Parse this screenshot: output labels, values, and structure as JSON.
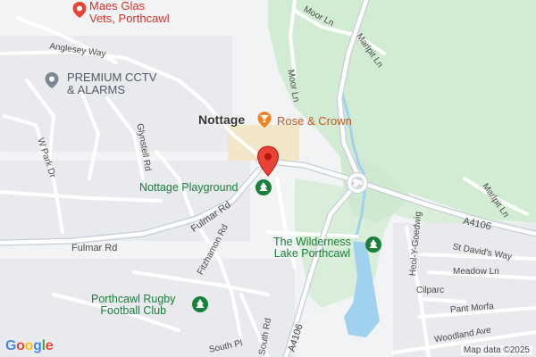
{
  "map": {
    "places": {
      "nottage": "Nottage"
    },
    "pois": {
      "maes_glas": {
        "line1": "Maes Glas",
        "line2": "Vets, Porthcawl"
      },
      "premium_cctv": {
        "line1": "PREMIUM CCTV",
        "line2": "& ALARMS"
      },
      "rose_crown": "Rose & Crown",
      "nottage_playground": "Nottage Playground",
      "wilderness_lake": {
        "line1": "The Wilderness",
        "line2": "Lake Porthcawl"
      },
      "porthcawl_rugby": {
        "line1": "Porthcawl Rugby",
        "line2": "Football Club"
      }
    },
    "roads": {
      "anglesey_way": "Anglesey Way",
      "moor_ln_top": "Moor Ln",
      "moor_ln_side": "Moor Ln",
      "marlpit_ln_top": "Marlpit Ln",
      "marlpit_ln_right": "Marlpit Ln",
      "w_park_dr": "W Park Dr",
      "glynstell_rd": "Glynstell Rd",
      "fulmar_rd_main": "Fulmar Rd",
      "fulmar_rd_diag": "Fulmar Rd",
      "fitzhamon_rd": "Fitzhamon Rd",
      "a4106_east": "A4106",
      "a4106_south": "A4106",
      "heol_y_goedwig": "Heol-Y-Goedwig",
      "st_davids_way": "St David's Way",
      "meadow_ln": "Meadow Ln",
      "cilparc": "Cilparc",
      "pant_morfa": "Pant Morfa",
      "woodland_ave": "Woodland Ave",
      "south_pl": "South Pl",
      "south_rd": "South Rd"
    },
    "attribution": {
      "google": [
        "G",
        "o",
        "o",
        "g",
        "l",
        "e"
      ],
      "map_data": "Map data ©2025"
    },
    "colors": {
      "land": "#f1f3f4",
      "park": "#d2ebd3",
      "water": "#a0d2f0",
      "road": "#ffffff",
      "major_road": "#c7cdd6",
      "pin": "#ea4335",
      "poi_red": "#d93025",
      "poi_green": "#188038",
      "poi_grey": "#5f6b78"
    },
    "icons": {
      "location_pin": "location-pin-icon",
      "vet_pin": "vet-pin-icon",
      "service_pin": "service-pin-icon",
      "bar_pin": "cocktail-pin-icon",
      "park_pin": "tree-pin-icon"
    }
  }
}
